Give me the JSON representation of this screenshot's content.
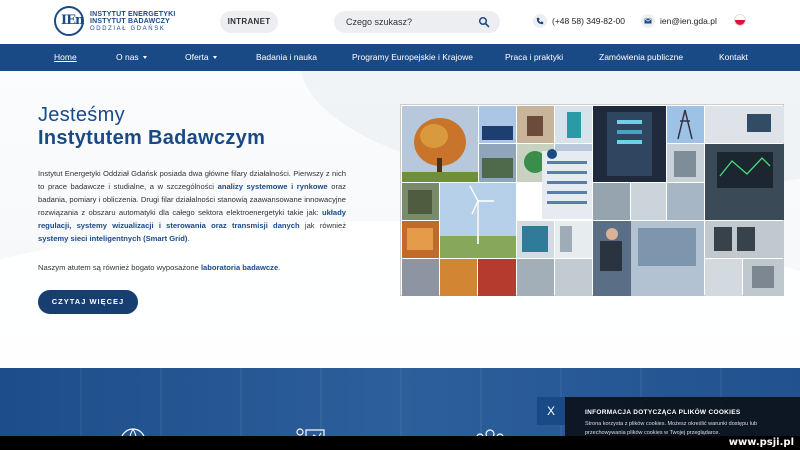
{
  "header": {
    "logo_line1": "INSTYTUT ENERGETYKI",
    "logo_line2": "INSTYTUT BADAWCZY",
    "logo_line3": "ODDZIAŁ GDAŃSK",
    "logo_mark": "IEn",
    "intranet_label": "INTRANET",
    "search_placeholder": "Czego szukasz?",
    "phone": "(+48 58) 349-82-00",
    "email": "ien@ien.gda.pl"
  },
  "nav": {
    "items": [
      {
        "label": "Home",
        "active": true
      },
      {
        "label": "O nas",
        "dropdown": true
      },
      {
        "label": "Oferta",
        "dropdown": true
      },
      {
        "label": "Badania i nauka"
      },
      {
        "label": "Programy Europejskie i Krajowe"
      },
      {
        "label": "Praca i praktyki"
      },
      {
        "label": "Zamówienia publiczne"
      },
      {
        "label": "Kontakt"
      }
    ]
  },
  "hero": {
    "title_line1": "Jesteśmy",
    "title_line2": "Instytutem Badawczym",
    "p1_a": "Instytut Energetyki Oddział Gdańsk posiada dwa główne filary działalności. Pierwszy z nich to prace badawcze i studialne, a w szczególności ",
    "p1_b": "analizy systemowe i rynkowe",
    "p1_c": " oraz badania, pomiary i obliczenia. Drugi filar działalności stanowią zaawansowane innowacyjne rozwiązania z obszaru automatyki dla całego sektora elektroenergetyki takie jak: ",
    "p1_d": "układy regulacji, systemy wizualizacji i sterowania oraz transmisji danych",
    "p1_e": " jak również ",
    "p1_f": "systemy sieci inteligentnych (Smart Grid)",
    "p1_g": ".",
    "p2_a": "Naszym atutem są również bogato wyposażone ",
    "p2_b": "laboratoria badawcze",
    "p2_c": ".",
    "cta_label": "CZYTAJ WIĘCEJ"
  },
  "cookie": {
    "close_label": "X",
    "title": "INFORMACJA DOTYCZĄCA PLIKÓW COOKIES",
    "text": "Strona korzysta z plików cookies. Możesz określić warunki dostępu lub przechowywania plików cookies w Twojej przeglądarce."
  },
  "watermark": "www.psji.pl",
  "colors": {
    "brand": "#1a4a86",
    "cta": "#173e70",
    "band": "#1d4d8a"
  }
}
